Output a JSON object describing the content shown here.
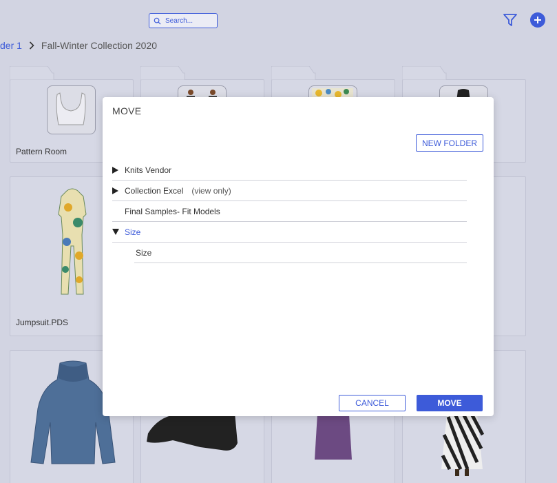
{
  "header": {
    "search_placeholder": "Search...",
    "filter_icon": "filter-icon",
    "add_icon": "plus-icon",
    "accent_color": "#3d5bd9"
  },
  "breadcrumb": {
    "parent": "der 1",
    "current": "Fall-Winter Collection 2020"
  },
  "cards": {
    "pattern_room": "Pattern Room",
    "jumpsuit": "Jumpsuit.PDS"
  },
  "modal": {
    "title": "MOVE",
    "new_folder_label": "NEW FOLDER",
    "cancel_label": "CANCEL",
    "move_label": "MOVE",
    "tree": [
      {
        "label": "Knits Vendor",
        "note": ""
      },
      {
        "label": "Collection Excel",
        "note": "(view only)"
      },
      {
        "label": "Final Samples- Fit Models",
        "note": ""
      },
      {
        "label": "Size",
        "note": ""
      },
      {
        "label": "Size",
        "note": ""
      }
    ]
  }
}
